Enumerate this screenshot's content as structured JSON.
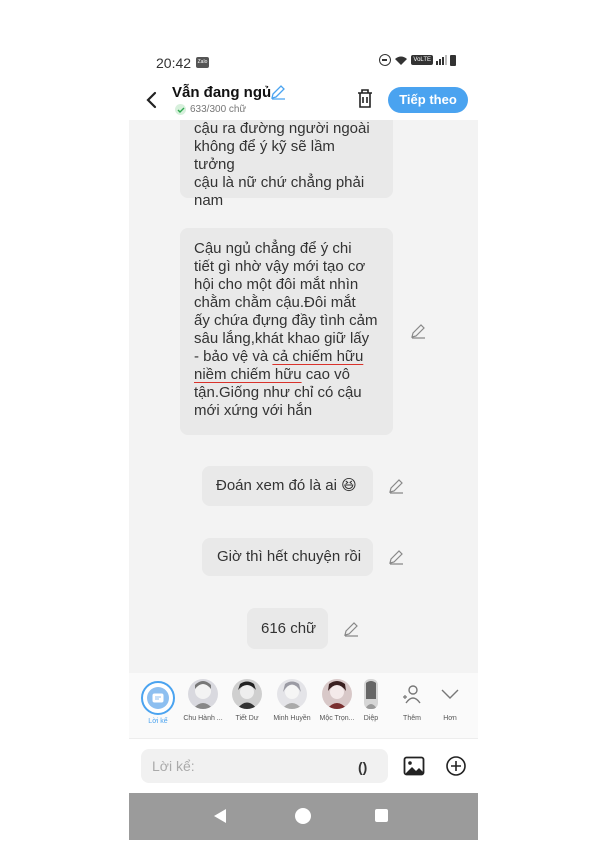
{
  "status_bar": {
    "time": "20:42",
    "app_badge": "Zalo",
    "volte": "VoLTE"
  },
  "header": {
    "title": "Vẫn đang ngủ",
    "word_count": "633/300 chữ",
    "next_button": "Tiếp theo"
  },
  "messages": [
    {
      "lines": [
        "cậu ra đường người ngoài",
        "không để ý kỹ sẽ lầm tưởng",
        "cậu là nữ chứ chẳng phải",
        "nam"
      ]
    },
    {
      "lines": [
        "Cậu ngủ chẳng để ý chi",
        "tiết gì nhờ vậy mới tạo cơ",
        "hội cho một đôi mắt nhìn",
        "chằm chằm cậu.Đôi mắt",
        "ấy chứa đựng đầy tình cảm",
        "sâu lắng,khát khao giữ lấy"
      ],
      "line7_pre": "- bảo vệ và ",
      "line7_hl": "cả chiếm hữu",
      "line8_hl": "niềm chiếm hữu",
      "line8_post": " cao vô",
      "tail_lines": [
        "tận.Giống như chỉ có cậu",
        "mới xứng với hắn"
      ]
    },
    {
      "text": "Đoán xem đó là ai 😆"
    },
    {
      "text": "Giờ thì hết chuyện rồi"
    },
    {
      "text": "616 chữ"
    }
  ],
  "narrator_bar": {
    "items": [
      {
        "label": "Lời kể",
        "selected": true
      },
      {
        "label": "Chu Hành ..."
      },
      {
        "label": "Tiết Dư"
      },
      {
        "label": "Minh Huyền"
      },
      {
        "label": "Mộc Trọn..."
      },
      {
        "label": "Diệp"
      },
      {
        "label": "Thêm"
      },
      {
        "label": "Hơn"
      }
    ]
  },
  "input": {
    "placeholder": "Lời kể:",
    "paren_button": "()"
  },
  "colors": {
    "accent": "#4aa3f0",
    "bubble": "#e9e9e9",
    "nav": "#9b9b9b",
    "underline": "#d9322b"
  }
}
